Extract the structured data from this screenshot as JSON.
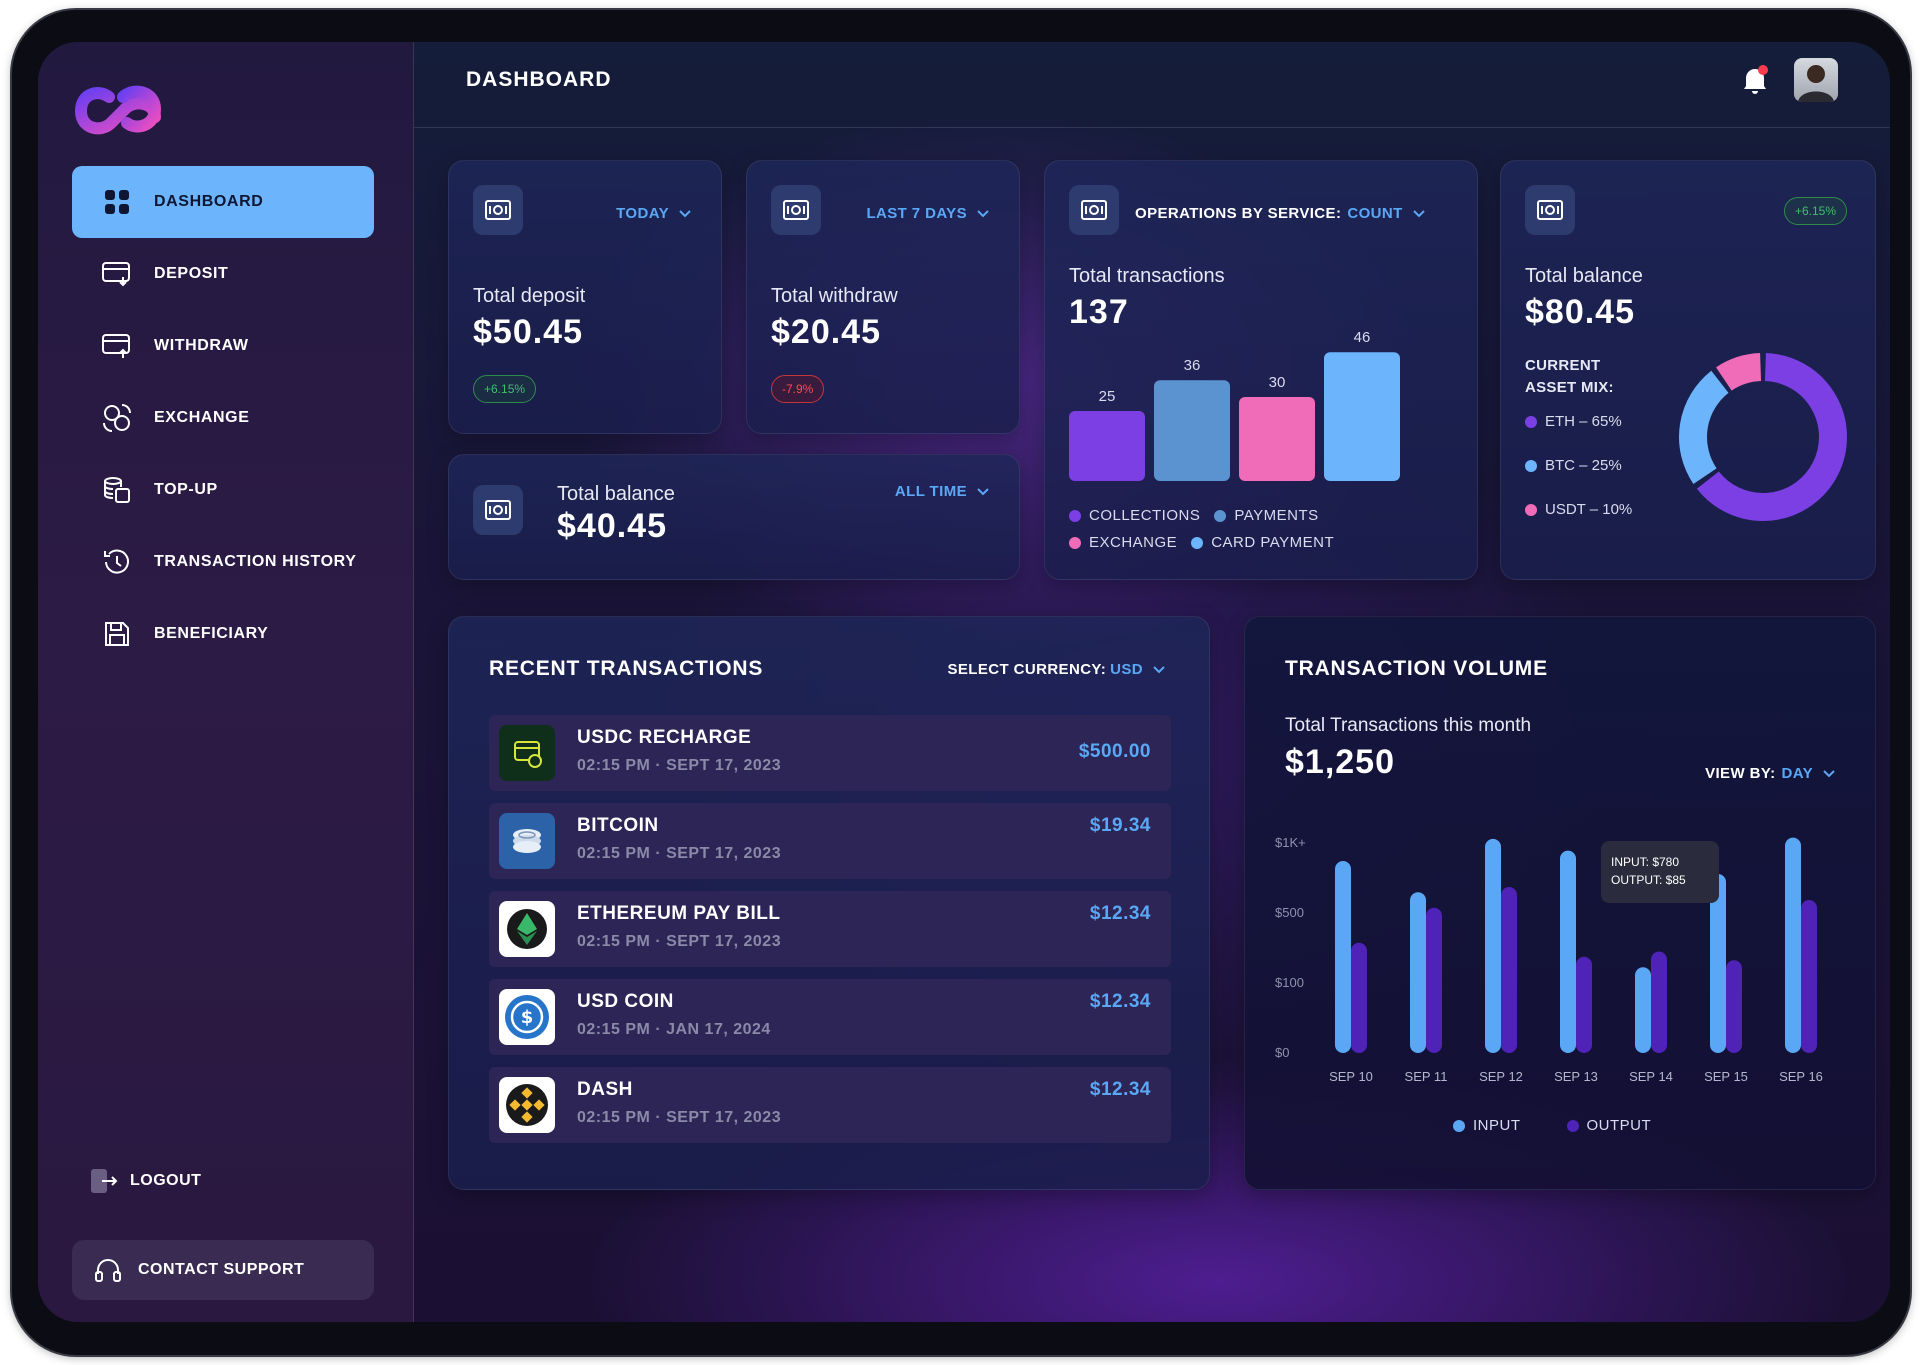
{
  "topbar": {
    "title": "DASHBOARD"
  },
  "sidebar": {
    "items": [
      {
        "label": "DASHBOARD",
        "icon": "grid-icon"
      },
      {
        "label": "DEPOSIT",
        "icon": "deposit-card-icon"
      },
      {
        "label": "WITHDRAW",
        "icon": "withdraw-card-icon"
      },
      {
        "label": "EXCHANGE",
        "icon": "exchange-icon"
      },
      {
        "label": "TOP-UP",
        "icon": "coins-stack-icon"
      },
      {
        "label": "TRANSACTION HISTORY",
        "icon": "history-clock-icon"
      },
      {
        "label": "BENEFICIARY",
        "icon": "save-icon"
      }
    ],
    "logout": "LOGOUT",
    "support": "CONTACT SUPPORT"
  },
  "cards": {
    "deposit": {
      "period": "TODAY",
      "label": "Total deposit",
      "value": "$50.45",
      "change": "+6.15%"
    },
    "withdraw": {
      "period": "LAST 7 DAYS",
      "label": "Total withdraw",
      "value": "$20.45",
      "change": "-7.9%"
    },
    "balance_all": {
      "period": "ALL TIME",
      "label": "Total balance",
      "value": "$40.45"
    },
    "operations": {
      "title_prefix": "OPERATIONS BY SERVICE:",
      "title_value": "COUNT",
      "label": "Total transactions",
      "value": "137",
      "legend": [
        "COLLECTIONS",
        "PAYMENTS",
        "EXCHANGE",
        "CARD PAYMENT"
      ]
    },
    "balance_mix": {
      "change": "+6.15%",
      "label": "Total balance",
      "value": "$80.45",
      "mix_title_1": "CURRENT",
      "mix_title_2": "ASSET MIX:",
      "items": [
        "ETH – 65%",
        "BTC – 25%",
        "USDT – 10%"
      ]
    }
  },
  "recent": {
    "title": "RECENT TRANSACTIONS",
    "currency_label": "SELECT CURRENCY:",
    "currency_value": "USD",
    "rows": [
      {
        "name": "USDC RECHARGE",
        "time": "02:15 PM · SEPT 17, 2023",
        "amount": "$500.00"
      },
      {
        "name": "BITCOIN",
        "time": "02:15 PM · SEPT 17, 2023",
        "amount": "$19.34"
      },
      {
        "name": "ETHEREUM PAY BILL",
        "time": "02:15 PM · SEPT 17, 2023",
        "amount": "$12.34"
      },
      {
        "name": "USD COIN",
        "time": "02:15 PM · JAN 17, 2024",
        "amount": "$12.34"
      },
      {
        "name": "DASH",
        "time": "02:15 PM · SEPT 17, 2023",
        "amount": "$12.34"
      }
    ]
  },
  "volume": {
    "title": "TRANSACTION VOLUME",
    "label": "Total Transactions this month",
    "value": "$1,250",
    "view_label": "VIEW BY:",
    "view_value": "DAY",
    "tooltip_1": "INPUT: $780",
    "tooltip_2": "OUTPUT: $85"
  },
  "colors": {
    "accent": "#6cb4fb",
    "purple": "#7b3fe4",
    "pink": "#f06bb8",
    "steel": "#5b93d1",
    "green": "#3fbf66",
    "red": "#ff4a4a"
  },
  "chart_data": [
    {
      "type": "bar",
      "categories": [
        "COLLECTIONS",
        "PAYMENTS",
        "EXCHANGE",
        "CARD PAYMENT"
      ],
      "values": [
        25,
        36,
        30,
        46
      ],
      "colors": [
        "#7b3fe4",
        "#5b93d1",
        "#f06bb8",
        "#6cb4fb"
      ]
    },
    {
      "type": "pie",
      "labels": [
        "ETH",
        "BTC",
        "USDT"
      ],
      "values": [
        65,
        25,
        10
      ],
      "colors": [
        "#7b3fe4",
        "#6cb4fb",
        "#f06bb8"
      ]
    },
    {
      "type": "bar",
      "categories": [
        "SEP 10",
        "SEP 11",
        "SEP 12",
        "SEP 13",
        "SEP 14",
        "SEP 15",
        "SEP 16"
      ],
      "yticks": [
        "$1K+",
        "$500",
        "$100",
        "$0"
      ],
      "series": [
        {
          "name": "INPUT",
          "values": [
            900,
            660,
            1070,
            980,
            190,
            800,
            1080
          ],
          "color": "#5aa8f5"
        },
        {
          "name": "OUTPUT",
          "values": [
            330,
            540,
            700,
            250,
            280,
            230,
            600
          ],
          "color": "#4f22b8"
        }
      ]
    }
  ]
}
